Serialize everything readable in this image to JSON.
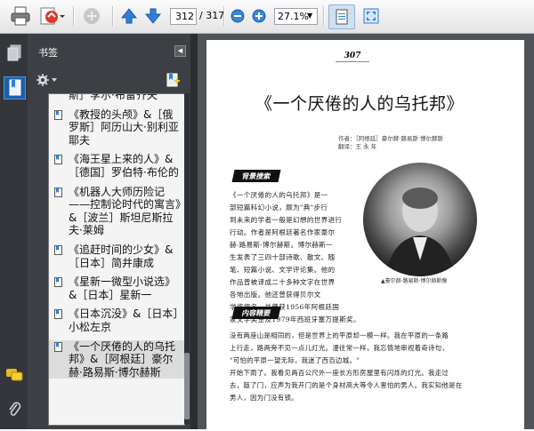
{
  "toolbar": {
    "page_current": "312",
    "page_total": "/ 317",
    "zoom": "27.1%"
  },
  "panel": {
    "title": "书签"
  },
  "bookmarks": [
    {
      "label": "斯］李尔·布雷齐夫",
      "selected": false
    },
    {
      "label": "《教授的头颅》&［俄罗斯］阿历山大·别利亚耶夫",
      "selected": false
    },
    {
      "label": "《海王星上来的人》&［德国］罗伯特·布伦的",
      "selected": false
    },
    {
      "label": "《机器人大师历险记——控制论时代的寓言》&［波兰］斯坦尼斯拉夫·莱姆",
      "selected": false
    },
    {
      "label": "《追赶时间的少女》&［日本］简井康成",
      "selected": false
    },
    {
      "label": "《星新一微型小说选》&［日本］星新一",
      "selected": false
    },
    {
      "label": "《日本沉没》&［日本］小松左京",
      "selected": false
    },
    {
      "label": "《一个厌倦的人的乌托邦》&［阿根廷］豪尔赫·路易斯·博尔赫斯",
      "selected": true
    }
  ],
  "document": {
    "page_number": "307",
    "title": "《一个厌倦的人的乌托邦》",
    "meta_author": "作者：［阿根廷］豪尔赫·路易斯·博尔赫斯",
    "meta_translator": "翻译：王 永 年",
    "section1": "背景搜索",
    "section2": "内容精要",
    "intro_lines": [
      "《一个厌倦的人的乌托邦》是一",
      "部短篇科幻小说，颇为\"典\"步行",
      "到未来的学者一般是幻想的世界进行",
      "行动。作者是阿根廷著名作家豪尔",
      "赫·路易斯·博尔赫斯。博尔赫斯一",
      "生发表了三四十部诗歌、散文、随",
      "笔、短篇小说、文学评论集。他的",
      "作品曾被译成二十多种文字在世界",
      "各地出版。他还曾获得贝尔文",
      "学奖提名，并曾获1956年阿根廷国",
      "家文学奖金及1979年西班牙塞万提斯奖。"
    ],
    "caption": "▲豪尔赫·路易斯·博尔赫斯像",
    "content_lines": [
      "没有两座山是相同的，但是世界上的平原却一模一样。我在平原的一条路",
      "上行走，路两旁不见一点儿灯光。漫往常一样，我忘情地审视着奇诗句，",
      "\"可怕的平原一望无际，我迷了西百边城。\"",
      "开始下雨了。我看见两百公尺外一座长方形房屋里有闪烁的灯光。我走过",
      "去，敲了门，应声为我开门的是个身材高大等令人害怕的男人。我实知他是在",
      "男人，因为门没有锁。"
    ]
  }
}
